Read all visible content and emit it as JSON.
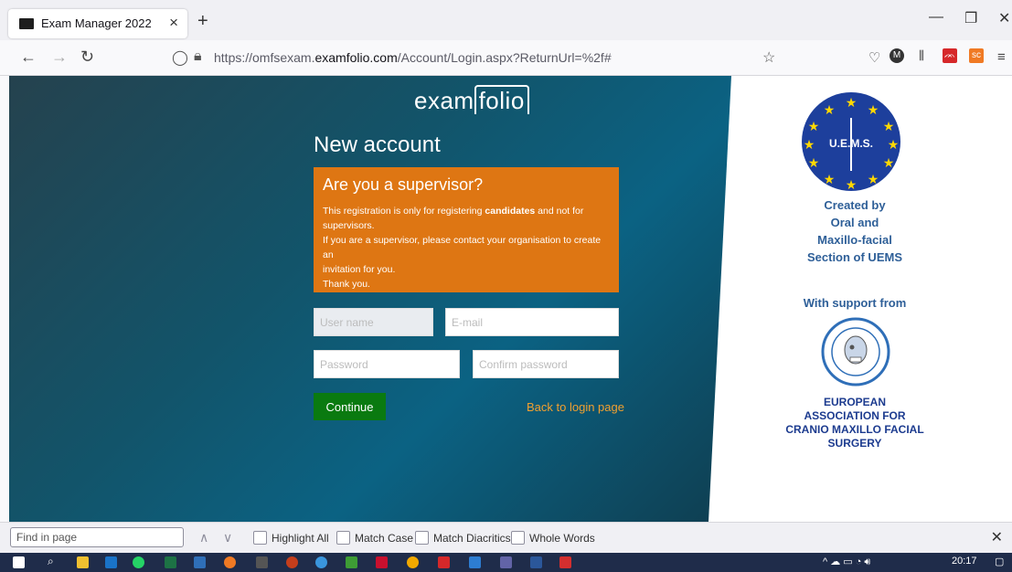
{
  "browser": {
    "tab_title": "Exam Manager 2022",
    "tab_close": "×",
    "new_tab": "+",
    "url_prefix": "https://omfsexam.",
    "url_domain": "examfolio.com",
    "url_suffix": "/Account/Login.aspx?ReturnUrl=%2f#",
    "window_minimize": "—",
    "window_restore": "❐",
    "window_close": "✕"
  },
  "page": {
    "logo_left": "exam",
    "logo_right": "folio",
    "heading": "New account",
    "notice": {
      "title": "Are you a supervisor?",
      "line1_pre": "This registration is only for registering ",
      "line1_bold": "candidates",
      "line1_post": " and not for",
      "line2": "supervisors.",
      "line3": "If you are a supervisor, please contact your organisation to create an",
      "line4": "invitation for you.",
      "line5": "Thank you."
    },
    "form": {
      "username_placeholder": "User name",
      "email_placeholder": "E-mail",
      "password_placeholder": "Password",
      "confirm_placeholder": "Confirm password",
      "continue_label": "Continue",
      "back_link": "Back to login page"
    },
    "sidebar": {
      "uems_badge": "U.E.M.S.",
      "created_lines": [
        "Created by",
        "Oral and",
        "Maxillo-facial",
        "Section of UEMS"
      ],
      "support": "With support from",
      "eacmfs_lines": [
        "EUROPEAN",
        "ASSOCIATION FOR",
        "CRANIO MAXILLO FACIAL",
        "SURGERY"
      ]
    }
  },
  "findbar": {
    "placeholder": "Find in page",
    "highlight_all": "Highlight All",
    "match_case": "Match Case",
    "match_diacritics": "Match Diacritics",
    "whole_words": "Whole Words"
  },
  "taskbar": {
    "time": "20:17"
  },
  "colors": {
    "notice_bg": "#de7613",
    "continue_bg": "#0a7a10",
    "link": "#f0a030",
    "sidebar_text": "#2e5f98"
  }
}
